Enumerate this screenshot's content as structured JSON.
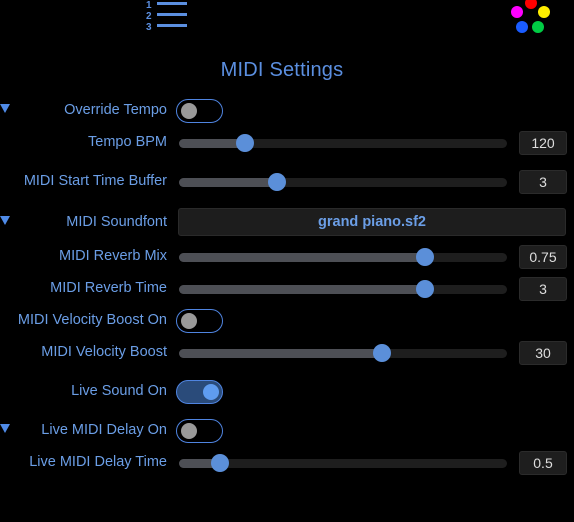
{
  "header": {
    "list_icon_numbers": [
      "1",
      "2",
      "3"
    ],
    "palette_colors": [
      "#ff0000",
      "#ff00ff",
      "#ffee00",
      "#1a5cff",
      "#00cc44"
    ]
  },
  "title": "MIDI Settings",
  "accent_color": "#5b8fe0",
  "settings": {
    "override_tempo": {
      "label": "Override Tempo",
      "on": false,
      "collapsible": true
    },
    "tempo_bpm": {
      "label": "Tempo BPM",
      "value": "120",
      "slider_fraction": 0.2
    },
    "start_time_buffer": {
      "label": "MIDI Start Time Buffer",
      "value": "3",
      "slider_fraction": 0.3
    },
    "soundfont": {
      "label": "MIDI Soundfont",
      "value": "grand piano.sf2",
      "collapsible": true
    },
    "reverb_mix": {
      "label": "MIDI Reverb Mix",
      "value": "0.75",
      "slider_fraction": 0.75
    },
    "reverb_time": {
      "label": "MIDI Reverb Time",
      "value": "3",
      "slider_fraction": 0.75
    },
    "velocity_boost_on": {
      "label": "MIDI Velocity Boost On",
      "on": false
    },
    "velocity_boost": {
      "label": "MIDI Velocity Boost",
      "value": "30",
      "slider_fraction": 0.62
    },
    "live_sound_on": {
      "label": "Live Sound On",
      "on": true
    },
    "live_midi_delay_on": {
      "label": "Live MIDI Delay On",
      "on": false,
      "collapsible": true
    },
    "live_midi_delay_time": {
      "label": "Live MIDI Delay Time",
      "value": "0.5",
      "slider_fraction": 0.125
    }
  }
}
